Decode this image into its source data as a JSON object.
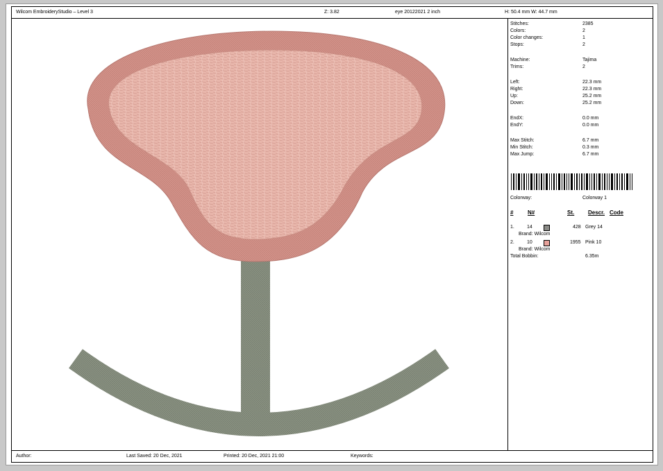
{
  "header": {
    "title": "Wilcom EmbroideryStudio – Level 3",
    "zoom": "Z: 3.82",
    "filename": "eye  20122021 2 inch",
    "dimensions": "H: 50.4 mm   W: 44.7 mm"
  },
  "stats": [
    {
      "label": "Stitches:",
      "value": "2385"
    },
    {
      "label": "Colors:",
      "value": "2"
    },
    {
      "label": "Color changes:",
      "value": "1"
    },
    {
      "label": "Stops:",
      "value": "2"
    },
    {
      "label": "Machine:",
      "value": "Tajima"
    },
    {
      "label": "Trims:",
      "value": "2"
    },
    {
      "label": "Left:",
      "value": "22.3 mm"
    },
    {
      "label": "Right:",
      "value": "22.3 mm"
    },
    {
      "label": "Up:",
      "value": "25.2 mm"
    },
    {
      "label": "Down:",
      "value": "25.2 mm"
    },
    {
      "label": "EndX:",
      "value": "0.0 mm"
    },
    {
      "label": "EndY:",
      "value": "0.0 mm"
    },
    {
      "label": "Max Stitch:",
      "value": "6.7 mm"
    },
    {
      "label": "Min Stitch:",
      "value": "0.3 mm"
    },
    {
      "label": "Max Jump:",
      "value": "6.7 mm"
    }
  ],
  "colorway": {
    "label": "Colorway:",
    "value": "Colorway 1"
  },
  "color_table": {
    "headers": {
      "num": "#",
      "code": "N#",
      "stitches": "St.",
      "descr": "Descr.",
      "code2": "Code"
    },
    "rows": [
      {
        "num": "1.",
        "code": "14",
        "swatch": "#8a8a86",
        "stitches": "428",
        "descr": "Grey 14",
        "brand": "Brand: Wilcom"
      },
      {
        "num": "2.",
        "code": "10",
        "swatch": "#e6a19a",
        "stitches": "1955",
        "descr": "Pink 10",
        "brand": "Brand: Wilcom"
      }
    ],
    "total_label": "Total Bobbin:",
    "total_value": "6.35m"
  },
  "footer": {
    "author": "Author:",
    "last_saved": "Last Saved: 20 Dec, 2021",
    "printed": "Printed: 20 Dec, 2021 21:00",
    "keywords": "Keywords:"
  },
  "colors": {
    "pink_outline": "#d4938a",
    "pink_fill": "#e8b6ab",
    "grey_thread": "#8a9282"
  }
}
